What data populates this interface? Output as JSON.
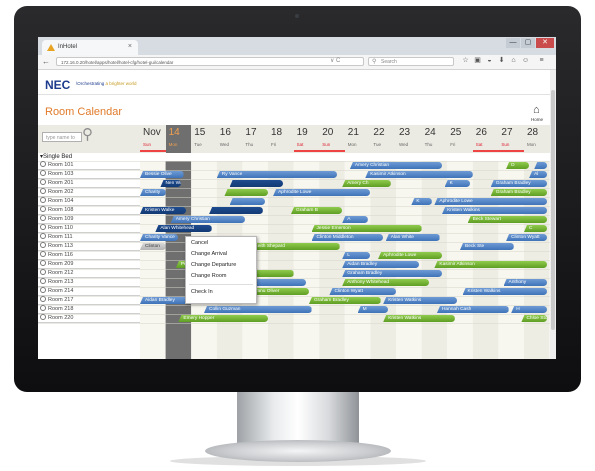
{
  "browser": {
    "tab_title": "InHotel",
    "tab_close": "×",
    "url": "172.16.0.20/hotel/apps/hotel/hotel-cfg/hotel-gui/calendar",
    "url_reload": "∨ C",
    "search_placeholder": "Search",
    "window_buttons": [
      "—",
      "▢",
      "✕"
    ]
  },
  "app": {
    "logo": "NEC",
    "tagline_prefix": "\\Orchestrating",
    "tagline_suffix": " a brighter world",
    "page_title": "Room  Calendar",
    "home_label": "Home",
    "filter_placeholder": "type name to"
  },
  "calendar": {
    "month_label": "Nov",
    "days": [
      {
        "num": "14",
        "wd": "Mon",
        "today": true
      },
      {
        "num": "15",
        "wd": "Tue"
      },
      {
        "num": "16",
        "wd": "Wed"
      },
      {
        "num": "17",
        "wd": "Thu"
      },
      {
        "num": "18",
        "wd": "Fri"
      },
      {
        "num": "19",
        "wd": "Sat",
        "weekend": true
      },
      {
        "num": "20",
        "wd": "Sun",
        "weekend": true
      },
      {
        "num": "21",
        "wd": "Mon"
      },
      {
        "num": "22",
        "wd": "Tue"
      },
      {
        "num": "23",
        "wd": "Wed"
      },
      {
        "num": "24",
        "wd": "Thu"
      },
      {
        "num": "25",
        "wd": "Fri"
      },
      {
        "num": "26",
        "wd": "Sat",
        "weekend": true
      },
      {
        "num": "27",
        "wd": "Sun",
        "weekend": true
      },
      {
        "num": "28",
        "wd": "Mon"
      }
    ],
    "first_day_weekday": "Sun",
    "group_label": "▾Single  Bed",
    "rooms": [
      "Room 101",
      "Room 103",
      "Room 201",
      "Room 202",
      "Room 104",
      "Room 108",
      "Room 109",
      "Room 110",
      "Room 111",
      "Room 113",
      "Room 116",
      "Room 209",
      "Room 212",
      "Room 213",
      "Room 214",
      "Room 217",
      "Room 218",
      "Room 220"
    ],
    "bookings": [
      {
        "row": 0,
        "start": 8.2,
        "end": 11.8,
        "color": "b",
        "name": "Amery Christian"
      },
      {
        "row": 0,
        "start": 14.3,
        "end": 15.2,
        "color": "g",
        "name": "D"
      },
      {
        "row": 0,
        "start": 15.4,
        "end": 15.9,
        "color": "b",
        "name": ""
      },
      {
        "row": 1,
        "start": 0,
        "end": 1.7,
        "color": "b",
        "name": "Bessie Olive"
      },
      {
        "row": 1,
        "start": 3.0,
        "end": 7.7,
        "color": "b",
        "name": "Ry Vance"
      },
      {
        "row": 1,
        "start": 8.8,
        "end": 13.0,
        "color": "b",
        "name": "Kasimir Atkinson"
      },
      {
        "row": 1,
        "start": 15.2,
        "end": 15.9,
        "color": "b",
        "name": "Al"
      },
      {
        "row": 2,
        "start": 0.8,
        "end": 1.6,
        "color": "d",
        "name": "Nen Wh"
      },
      {
        "row": 2,
        "start": 3.5,
        "end": 5.6,
        "color": "d",
        "name": ""
      },
      {
        "row": 2,
        "start": 7.9,
        "end": 9.8,
        "color": "g",
        "name": "Amery Ch"
      },
      {
        "row": 2,
        "start": 11.9,
        "end": 12.9,
        "color": "b",
        "name": "K"
      },
      {
        "row": 2,
        "start": 13.7,
        "end": 15.9,
        "color": "b",
        "name": "Graham Bradley"
      },
      {
        "row": 3,
        "start": 0,
        "end": 1.0,
        "color": "b",
        "name": "Charity"
      },
      {
        "row": 3,
        "start": 3.3,
        "end": 5.0,
        "color": "g",
        "name": ""
      },
      {
        "row": 3,
        "start": 5.2,
        "end": 9.0,
        "color": "b",
        "name": "Aphrodite Lowe"
      },
      {
        "row": 3,
        "start": 13.7,
        "end": 15.9,
        "color": "g",
        "name": "Graham Bradley"
      },
      {
        "row": 4,
        "start": 3.5,
        "end": 4.9,
        "color": "b",
        "name": ""
      },
      {
        "row": 4,
        "start": 10.6,
        "end": 11.4,
        "color": "b",
        "name": "K"
      },
      {
        "row": 4,
        "start": 11.5,
        "end": 15.9,
        "color": "b",
        "name": "Aphrodite Lowe"
      },
      {
        "row": 5,
        "start": 0,
        "end": 1.8,
        "color": "d",
        "name": "Kristen Walke"
      },
      {
        "row": 5,
        "start": 2.7,
        "end": 4.8,
        "color": "d",
        "name": ""
      },
      {
        "row": 5,
        "start": 5.9,
        "end": 7.9,
        "color": "g",
        "name": "Graham B"
      },
      {
        "row": 5,
        "start": 11.8,
        "end": 15.9,
        "color": "b",
        "name": "Kristen Walkins"
      },
      {
        "row": 6,
        "start": 1.2,
        "end": 4.1,
        "color": "b",
        "name": "Amery Christian"
      },
      {
        "row": 6,
        "start": 7.9,
        "end": 8.9,
        "color": "b",
        "name": "A"
      },
      {
        "row": 6,
        "start": 12.8,
        "end": 15.9,
        "color": "g",
        "name": "Beck Stewart"
      },
      {
        "row": 7,
        "start": 0.6,
        "end": 2.8,
        "color": "d",
        "name": "Alan Whitehead"
      },
      {
        "row": 7,
        "start": 6.7,
        "end": 11.0,
        "color": "g",
        "name": "Jessie Emerson"
      },
      {
        "row": 7,
        "start": 15.0,
        "end": 15.9,
        "color": "g",
        "name": "C"
      },
      {
        "row": 8,
        "start": 0,
        "end": 1.5,
        "color": "b",
        "name": "Charity Vance"
      },
      {
        "row": 8,
        "start": 6.7,
        "end": 9.5,
        "color": "b",
        "name": "Clinton Middleton"
      },
      {
        "row": 8,
        "start": 9.6,
        "end": 11.7,
        "color": "b",
        "name": "Alan White"
      },
      {
        "row": 8,
        "start": 14.3,
        "end": 15.9,
        "color": "b",
        "name": "Clinton Wyatt"
      },
      {
        "row": 9,
        "start": 0,
        "end": 1.0,
        "color": "gr",
        "name": "Clinton"
      },
      {
        "row": 9,
        "start": 4.3,
        "end": 7.8,
        "color": "g",
        "name": "Leith Shepard"
      },
      {
        "row": 9,
        "start": 12.5,
        "end": 14.6,
        "color": "b",
        "name": "Beck Ste"
      },
      {
        "row": 10,
        "start": 7.9,
        "end": 9.0,
        "color": "b",
        "name": "L"
      },
      {
        "row": 10,
        "start": 9.3,
        "end": 11.8,
        "color": "g",
        "name": "Aphrodite Lowe"
      },
      {
        "row": 11,
        "start": 1.4,
        "end": 3.3,
        "color": "g",
        "name": "Peter Ross"
      },
      {
        "row": 11,
        "start": 7.9,
        "end": 10.9,
        "color": "b",
        "name": "Aidan Bradley"
      },
      {
        "row": 11,
        "start": 11.5,
        "end": 15.9,
        "color": "g",
        "name": "Kasimir Atkinson"
      },
      {
        "row": 12,
        "start": 2.3,
        "end": 6.0,
        "color": "g",
        "name": "Anthony Whitehead"
      },
      {
        "row": 12,
        "start": 7.9,
        "end": 11.8,
        "color": "b",
        "name": "Graham Bradley"
      },
      {
        "row": 13,
        "start": 3.2,
        "end": 6.5,
        "color": "b",
        "name": "Hannah Cash"
      },
      {
        "row": 13,
        "start": 7.9,
        "end": 11.3,
        "color": "g",
        "name": "Anthony Whitehead"
      },
      {
        "row": 13,
        "start": 14.2,
        "end": 15.9,
        "color": "b",
        "name": "Anthony"
      },
      {
        "row": 14,
        "start": 4.3,
        "end": 6.6,
        "color": "g",
        "name": "Tanu Oliver"
      },
      {
        "row": 14,
        "start": 7.4,
        "end": 10.0,
        "color": "b",
        "name": "Clinton Wyatt"
      },
      {
        "row": 14,
        "start": 12.6,
        "end": 15.9,
        "color": "b",
        "name": "Kristen Walkins"
      },
      {
        "row": 15,
        "start": 0,
        "end": 2.4,
        "color": "b",
        "name": "Aidan Bradley"
      },
      {
        "row": 15,
        "start": 6.6,
        "end": 9.4,
        "color": "g",
        "name": "Graham Bradley"
      },
      {
        "row": 15,
        "start": 9.5,
        "end": 12.4,
        "color": "b",
        "name": "Kristen Watkins"
      },
      {
        "row": 16,
        "start": 2.5,
        "end": 6.7,
        "color": "b",
        "name": "Collin Guzman"
      },
      {
        "row": 16,
        "start": 8.5,
        "end": 9.7,
        "color": "b",
        "name": "M"
      },
      {
        "row": 16,
        "start": 11.6,
        "end": 14.4,
        "color": "b",
        "name": "Hannah Cash"
      },
      {
        "row": 16,
        "start": 14.5,
        "end": 15.9,
        "color": "b",
        "name": "H"
      },
      {
        "row": 17,
        "start": 1.5,
        "end": 5.0,
        "color": "g",
        "name": "Emery Hopper"
      },
      {
        "row": 17,
        "start": 9.5,
        "end": 12.3,
        "color": "g",
        "name": "Kristen Watkins"
      },
      {
        "row": 17,
        "start": 14.9,
        "end": 15.9,
        "color": "g",
        "name": "Chloe Sto"
      }
    ]
  },
  "context_menu": {
    "items": [
      "Cancel",
      "Change Arrival",
      "Change Departure",
      "Change Room",
      "Check In"
    ]
  },
  "colors": {
    "accent_orange": "#e07b2a",
    "brand_blue": "#1c3b8c",
    "booking_blue": "#3f73b8",
    "booking_green": "#5e9e24",
    "booking_dark": "#123a74",
    "weekend_red": "#e44444"
  }
}
